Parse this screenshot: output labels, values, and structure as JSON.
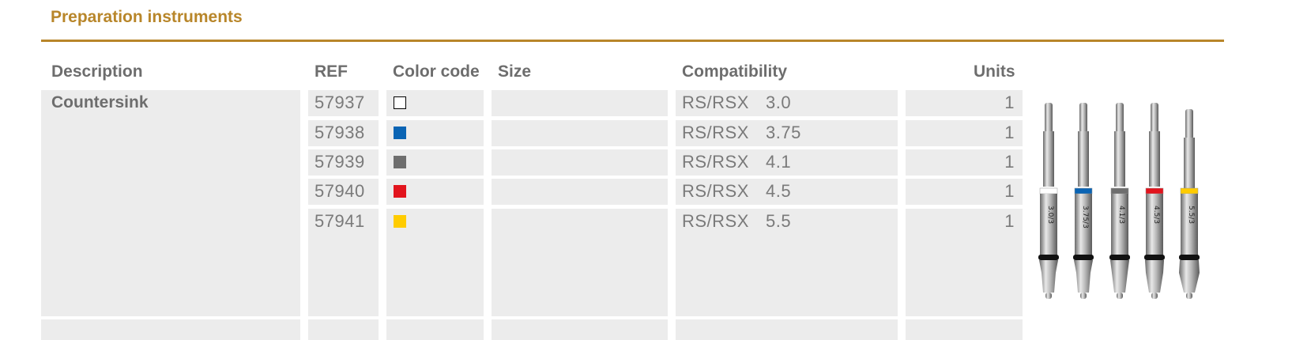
{
  "section_title": "Preparation instruments",
  "headers": {
    "description": "Description",
    "ref": "REF",
    "color_code": "Color code",
    "size": "Size",
    "compatibility": "Compatibility",
    "units": "Units"
  },
  "description": "Countersink",
  "rows": [
    {
      "ref": "57937",
      "color": "#ffffff",
      "color_border": "#000000",
      "compat_line": "RS/RSX",
      "compat_dia": "3.0",
      "units": "1"
    },
    {
      "ref": "57938",
      "color": "#0a64b4",
      "color_border": "#0a64b4",
      "compat_line": "RS/RSX",
      "compat_dia": "3.75",
      "units": "1"
    },
    {
      "ref": "57939",
      "color": "#6e6e6e",
      "color_border": "#6e6e6e",
      "compat_line": "RS/RSX",
      "compat_dia": "4.1",
      "units": "1"
    },
    {
      "ref": "57940",
      "color": "#e2141d",
      "color_border": "#e2141d",
      "compat_line": "RS/RSX",
      "compat_dia": "4.5",
      "units": "1"
    },
    {
      "ref": "57941",
      "color": "#ffcc00",
      "color_border": "#ffcc00",
      "compat_line": "RS/RSX",
      "compat_dia": "5.5",
      "units": "1"
    }
  ],
  "instrument_image": {
    "markings": [
      "3.0/3",
      "3.75/3",
      "4.1/3",
      "4.5/3",
      "5.5/3"
    ],
    "bands": [
      "#ffffff",
      "#0a64b4",
      "#6e6e6e",
      "#e2141d",
      "#ffcc00"
    ]
  },
  "colors": {
    "accent": "#b8862a",
    "cell_bg": "#ececec",
    "text": "#7a7a7a"
  }
}
